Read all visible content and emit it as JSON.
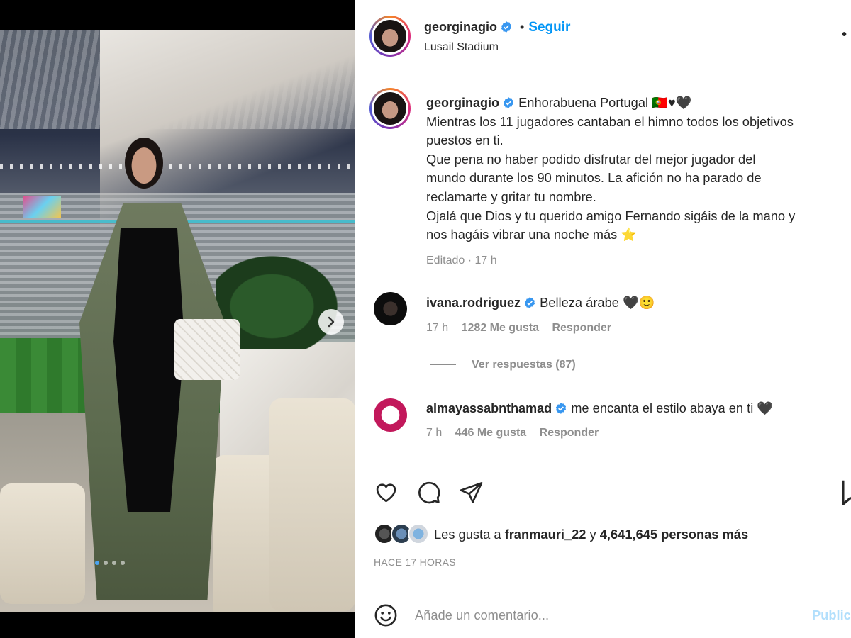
{
  "post": {
    "author": "georginagio",
    "follow_label": "Seguir",
    "separator": "•",
    "location": "Lusail Stadium",
    "more_label": "•",
    "carousel": {
      "slide_count": 4,
      "active_index": 0
    }
  },
  "caption": {
    "author": "georginagio",
    "lines": [
      "Enhorabuena Portugal 🇵🇹♥🖤",
      "Mientras los 11 jugadores cantaban el himno todos los objetivos",
      "puestos en ti.",
      "Que pena no haber podido disfrutar del mejor jugador del",
      "mundo durante los 90 minutos. La afición no ha parado de",
      "reclamarte y gritar tu nombre.",
      "Ojalá que Dios y tu querido amigo Fernando sigáis de la mano y",
      "nos hagáis vibrar una noche más ⭐"
    ],
    "edited": "Editado · 17 h"
  },
  "comments": [
    {
      "user": "ivana.rodriguez",
      "text": "Belleza árabe 🖤🙂",
      "time": "17 h",
      "likes": "1282 Me gusta",
      "reply": "Responder",
      "view_replies": "Ver respuestas (87)"
    },
    {
      "user": "almayassabnthamad",
      "text": "me encanta el estilo abaya en ti 🖤",
      "time": "7 h",
      "likes": "446 Me gusta",
      "reply": "Responder"
    }
  ],
  "likes": {
    "prefix": "Les gusta a ",
    "user": "franmauri_22",
    "middle": " y ",
    "count": "4,641,645 personas más"
  },
  "timestamp": "HACE 17 HORAS",
  "comment_box": {
    "placeholder": "Añade un comentario...",
    "publish": "Publicar"
  },
  "colors": {
    "accent": "#0095f6",
    "verified": "#3897f0",
    "secondary_text": "#8e8e8e"
  },
  "icons": {
    "like": "heart-icon",
    "comment": "comment-icon",
    "share": "paper-plane-icon",
    "save": "bookmark-icon",
    "emoji": "emoji-icon",
    "next": "chevron-right-icon",
    "verified": "verified-badge-icon"
  }
}
